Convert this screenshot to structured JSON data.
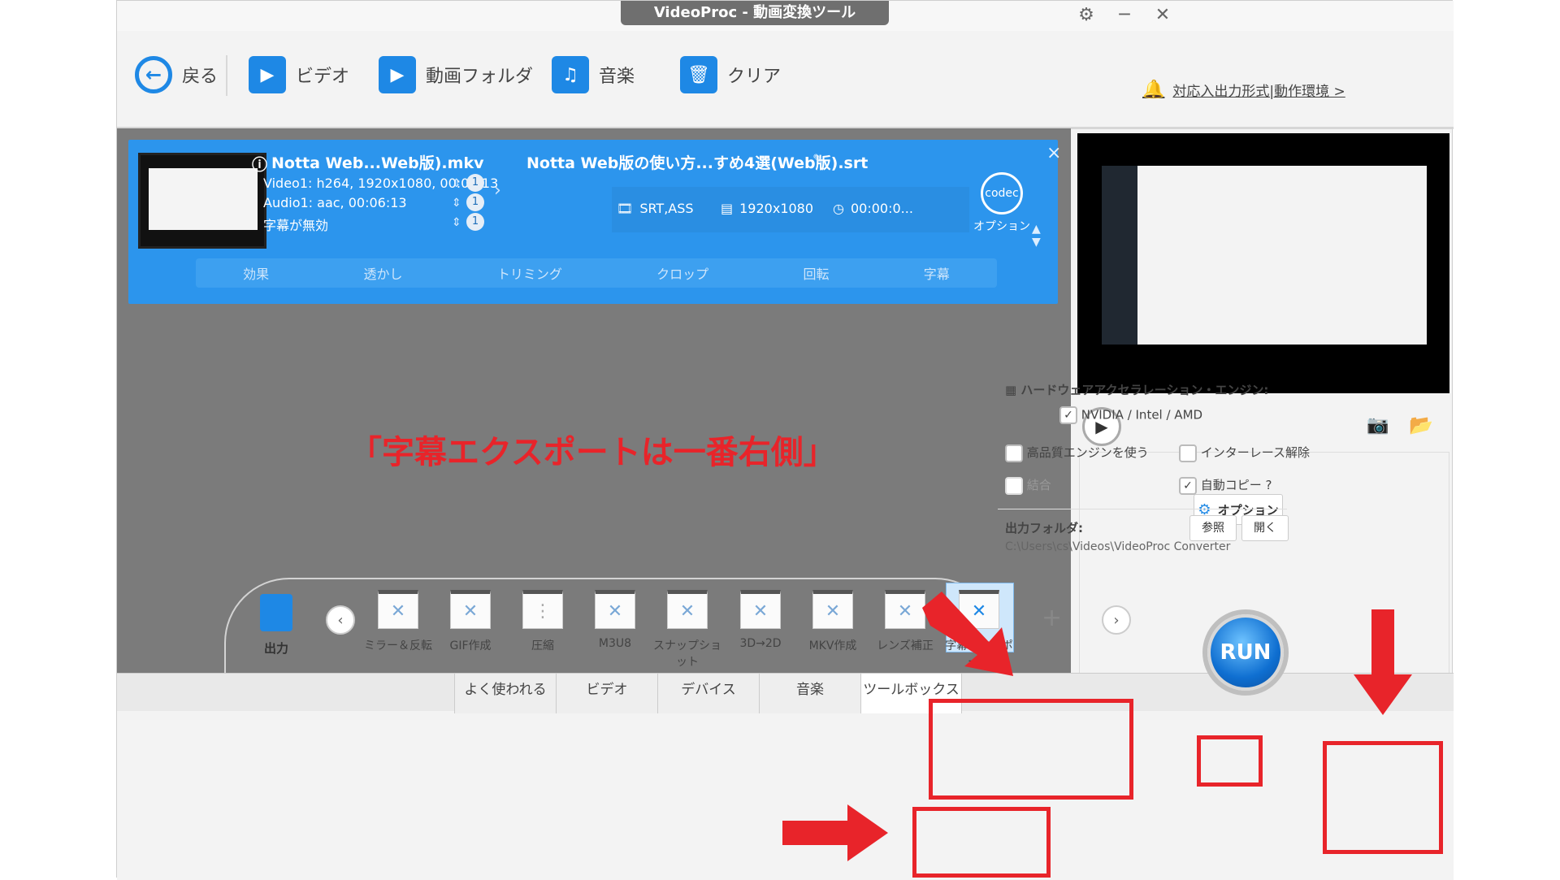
{
  "window": {
    "title": "VideoProc - 動画変換ツール",
    "gear_icon": "gear-icon",
    "min_label": "─",
    "close_label": "✕"
  },
  "toolbar": {
    "back": "戻る",
    "video": "ビデオ",
    "folder": "動画フォルダ",
    "music": "音楽",
    "clear": "クリア",
    "formats_link": "対応入出力形式|動作環境 >"
  },
  "file": {
    "source_name": "Notta Web...Web版).mkv",
    "video_track": "Video1: h264, 1920x1080, 00:06:13",
    "audio_track": "Audio1: aac, 00:06:13",
    "subtitle_track": "字幕が無効",
    "track_count": "1",
    "output_name": "Notta Web版の使い方...すめ4選(Web版).srt",
    "format": "SRT,ASS",
    "resolution": "1920x1080",
    "duration": "00:00:0...",
    "option_label": "オプション",
    "codec_label": "codec"
  },
  "edit_tools": [
    "効果",
    "透かし",
    "トリミング",
    "クロップ",
    "回転",
    "字幕"
  ],
  "settings": {
    "hw_title": "ハードウェアアクセラレーション・エンジン:",
    "hw_vendor": "NVIDIA / Intel / AMD",
    "hw_option": "オプション",
    "hq_engine": "高品質エンジンを使う",
    "deinterlace": "インターレース解除",
    "merge": "結合",
    "autocopy": "自動コピー ?",
    "output_folder_label": "出力フォルダ:",
    "browse": "参照",
    "open": "開く",
    "output_path": "C:\\Users\\cs\\Videos\\VideoProc Converter"
  },
  "tools": [
    {
      "label": "ミラー＆反転"
    },
    {
      "label": "GIF作成"
    },
    {
      "label": "圧縮"
    },
    {
      "label": "M3U8"
    },
    {
      "label": "スナップショット"
    },
    {
      "label": "3D→2D"
    },
    {
      "label": "MKV作成"
    },
    {
      "label": "レンズ補正"
    },
    {
      "label": "字幕エクスポート"
    }
  ],
  "output_label": "出力",
  "add_label": "+",
  "tabs": [
    "よく使われる",
    "ビデオ",
    "デバイス",
    "音楽",
    "ツールボックス"
  ],
  "run_label": "RUN",
  "annotation": "「字幕エクスポートは一番右側」",
  "colors": {
    "accent": "#1e88e5",
    "card": "#2c95ed",
    "annotation": "#e8242a"
  }
}
